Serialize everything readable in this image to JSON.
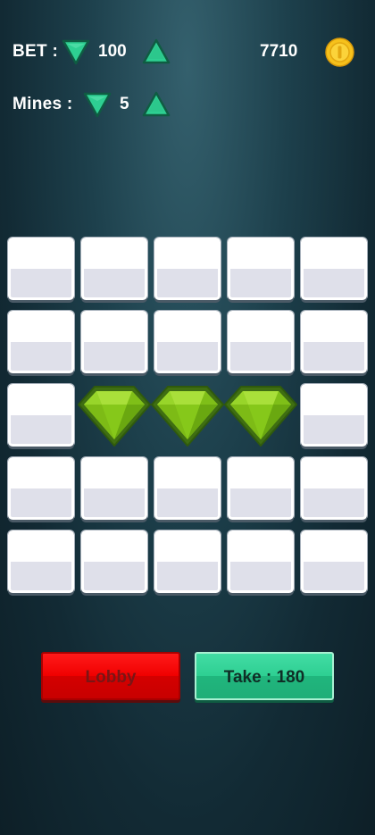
{
  "bet": {
    "label": "BET :",
    "value": "100",
    "decrease_icon": "triangle-down-icon",
    "increase_icon": "triangle-up-icon"
  },
  "mines": {
    "label": "Mines :",
    "value": "5",
    "decrease_icon": "triangle-down-icon",
    "increase_icon": "triangle-up-icon"
  },
  "balance": {
    "value": "7710",
    "icon": "gold-coin-icon"
  },
  "board": {
    "rows": 5,
    "cols": 5,
    "tiles": [
      [
        "hidden",
        "hidden",
        "hidden",
        "hidden",
        "hidden"
      ],
      [
        "hidden",
        "hidden",
        "hidden",
        "hidden",
        "hidden"
      ],
      [
        "hidden",
        "gem",
        "gem",
        "gem",
        "hidden"
      ],
      [
        "hidden",
        "hidden",
        "hidden",
        "hidden",
        "hidden"
      ],
      [
        "hidden",
        "hidden",
        "hidden",
        "hidden",
        "hidden"
      ]
    ],
    "revealed_icon": "green-gem-icon"
  },
  "buttons": {
    "lobby_label": "Lobby",
    "take_label": "Take : 180"
  },
  "colors": {
    "arrow_fill": "#2ecf92",
    "arrow_stroke": "#0f5c42",
    "lobby_red": "#f00000",
    "take_green": "#2ecf92",
    "gem_green": "#8fce1e",
    "coin_gold": "#f6c11c"
  }
}
